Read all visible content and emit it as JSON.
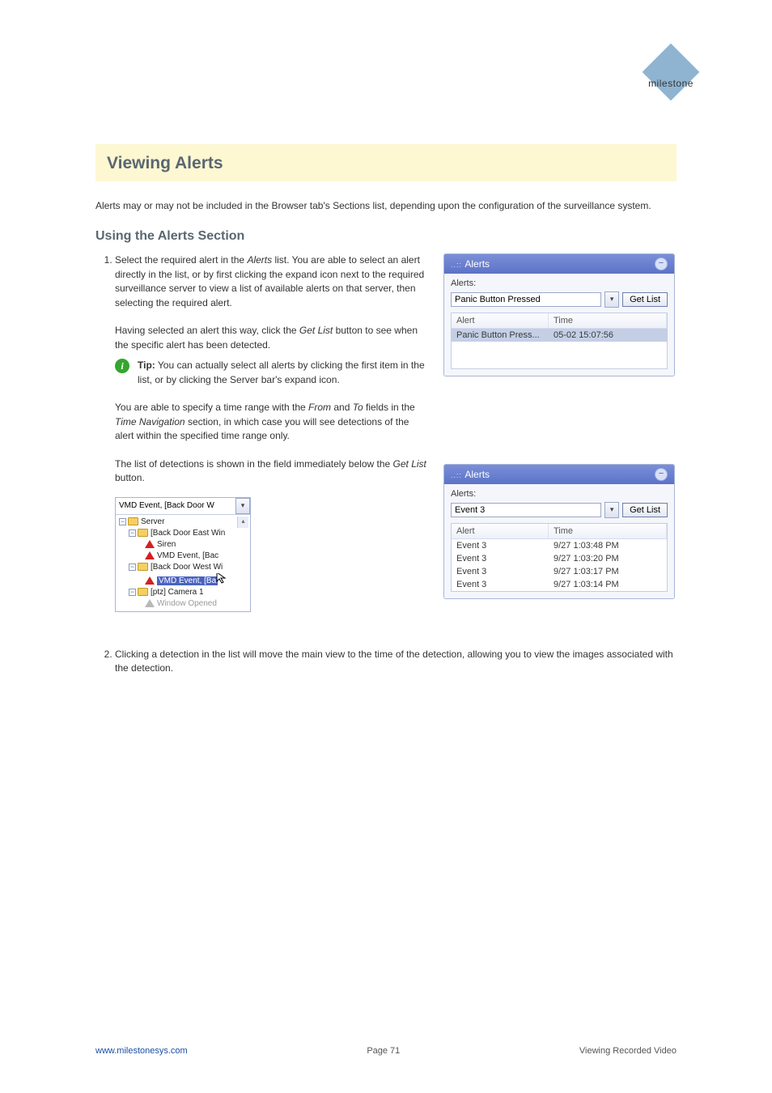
{
  "logo": {
    "text": "milestone"
  },
  "topic_title": "Viewing Alerts",
  "intro_p": "Alerts may or may not be included in the Browser tab's Sections list, depending upon the configuration of the surveillance system.",
  "section1_title": "Using the Alerts Section",
  "steps": {
    "s1_head": "1.",
    "s1": "Select the required alert in the Alerts list. You are able to select an alert directly in the list, or by first clicking the expand icon next to the required surveillance server to view a list of available alerts on that server, then selecting the required alert.",
    "s2": "Having selected an alert this way, click the Get List button to see when the specific alert has been detected.",
    "tip": "Tip: You can actually select all alerts by clicking the first item in the list, or by clicking the Server bar's expand icon.",
    "s3": "You are able to specify a time range with the From and To fields in the Time Navigation section, in which case you will see detections of the alert within the specified time range only.",
    "s4": "The list of detections is shown in the field immediately below the Get List button.",
    "s5": "Clicking a detection in the list will move the main view to the time of the detection, allowing you to view the images associated with the detection."
  },
  "alerts_panel1": {
    "title": "Alerts",
    "label": "Alerts:",
    "dropdown_value": "Panic Button Pressed",
    "getlist": "Get List",
    "columns": {
      "alert": "Alert",
      "time": "Time"
    },
    "rows": [
      {
        "alert": "Panic Button Press...",
        "time": "05-02 15:07:56"
      }
    ]
  },
  "alerts_panel2": {
    "title": "Alerts",
    "label": "Alerts:",
    "dropdown_value": "Event 3",
    "getlist": "Get List",
    "columns": {
      "alert": "Alert",
      "time": "Time"
    },
    "rows": [
      {
        "alert": "Event 3",
        "time": "9/27 1:03:48 PM"
      },
      {
        "alert": "Event 3",
        "time": "9/27 1:03:20 PM"
      },
      {
        "alert": "Event 3",
        "time": "9/27 1:03:17 PM"
      },
      {
        "alert": "Event 3",
        "time": "9/27 1:03:14 PM"
      }
    ]
  },
  "tree": {
    "top_value": "VMD Event, [Back Door W",
    "lines": {
      "server": "Server",
      "bdeast": "[Back Door East Win",
      "siren": "Siren",
      "vmd_bac": "VMD Event, [Bac",
      "bdwest": "[Back Door West Wi",
      "vmd_sel": "VMD Event, [Ba",
      "ptz": "[ptz] Camera 1",
      "winopen": "Window Opened"
    }
  },
  "footer": {
    "left_link": "www.milestonesys.com",
    "page": "Page 71",
    "right": "Viewing Recorded Video"
  }
}
